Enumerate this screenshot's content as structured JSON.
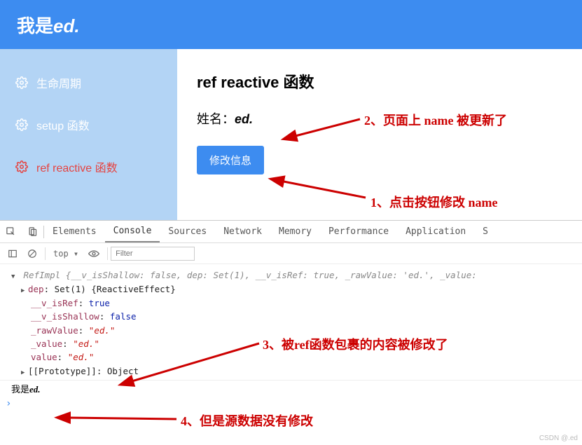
{
  "header": {
    "prefix": "我是",
    "suffix": "ed."
  },
  "sidebar": {
    "items": [
      {
        "label": "生命周期"
      },
      {
        "label": "setup 函数"
      },
      {
        "label": "ref reactive 函数"
      }
    ]
  },
  "main": {
    "title": "ref reactive 函数",
    "name_label": "姓名：",
    "name_value": "ed.",
    "button": "修改信息"
  },
  "annotations": {
    "a1": "1、点击按钮修改 name",
    "a2": "2、页面上 name 被更新了",
    "a3": "3、被ref函数包裹的内容被修改了",
    "a4": "4、但是源数据没有修改"
  },
  "devtools": {
    "tabs": [
      "Elements",
      "Console",
      "Sources",
      "Network",
      "Memory",
      "Performance",
      "Application",
      "S"
    ],
    "active_tab": 1,
    "top_label": "top ▾",
    "filter_placeholder": "Filter",
    "lines": {
      "l0a": "RefImpl {__v_isShallow: ",
      "l0b": "false",
      "l0c": ", dep: Set(1), __v_isRef: ",
      "l0d": "true",
      "l0e": ", _rawValue: ",
      "l0f": "'ed.'",
      "l0g": ", _value:",
      "l1": "dep",
      "l1b": ": Set(1) {ReactiveEffect}",
      "l2": "__v_isRef",
      "l2b": "true",
      "l3": "__v_isShallow",
      "l3b": "false",
      "l4": "_rawValue",
      "l4b": "\"ed.\"",
      "l5": "_value",
      "l5b": "\"ed.\"",
      "l6": "value",
      "l6b": "\"ed.\"",
      "l7a": "[[Prototype]]",
      "l7b": ": Object",
      "bottom_prefix": "我是",
      "bottom_suffix": "ed."
    }
  },
  "watermark": "CSDN @.ed"
}
